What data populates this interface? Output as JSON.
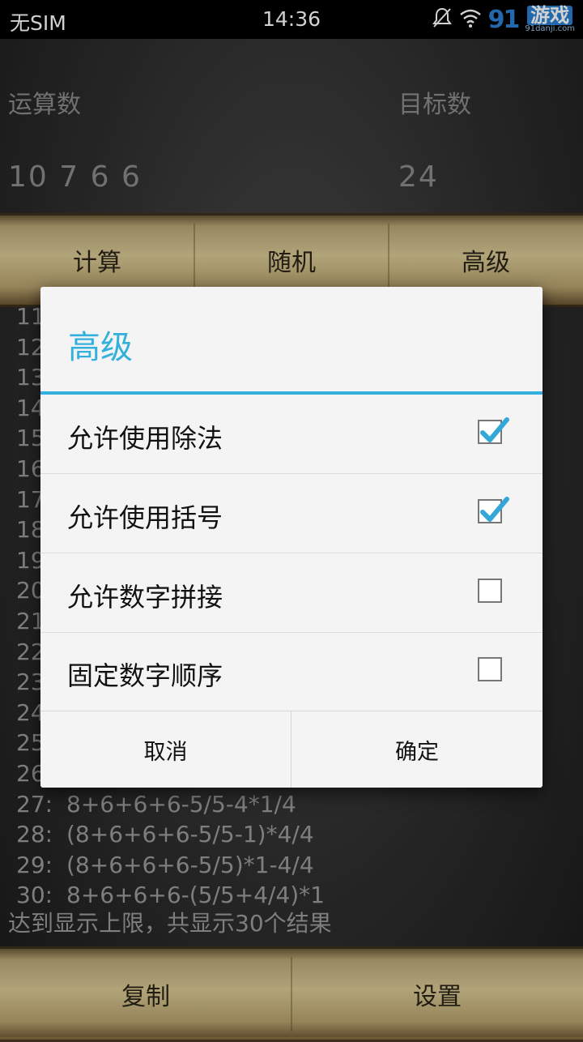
{
  "status_bar": {
    "carrier": "无SIM",
    "time": "14:36",
    "watermark_number": "91",
    "watermark_text": "游戏",
    "watermark_site": "91danji.com"
  },
  "inputs": {
    "operands_label": "运算数",
    "operands_value": "10 7 6 6",
    "target_label": "目标数",
    "target_value": "24"
  },
  "toolbar": {
    "calculate": "计算",
    "random": "随机",
    "advanced": "高级"
  },
  "results": [
    {
      "idx": "11",
      "expr": ""
    },
    {
      "idx": "12",
      "expr": ""
    },
    {
      "idx": "13",
      "expr": ""
    },
    {
      "idx": "14",
      "expr": ""
    },
    {
      "idx": "15",
      "expr": ""
    },
    {
      "idx": "16",
      "expr": ""
    },
    {
      "idx": "17",
      "expr": ""
    },
    {
      "idx": "18",
      "expr": ""
    },
    {
      "idx": "19",
      "expr": ""
    },
    {
      "idx": "20",
      "expr": ""
    },
    {
      "idx": "21",
      "expr": ""
    },
    {
      "idx": "22",
      "expr": ""
    },
    {
      "idx": "23",
      "expr": ""
    },
    {
      "idx": "24",
      "expr": ""
    },
    {
      "idx": "25",
      "expr": ""
    },
    {
      "idx": "26",
      "expr": ""
    },
    {
      "idx": "27:",
      "expr": "8+6+6+6-5/5-4*1/4"
    },
    {
      "idx": "28:",
      "expr": "(8+6+6+6-5/5-1)*4/4"
    },
    {
      "idx": "29:",
      "expr": "(8+6+6+6-5/5)*1-4/4"
    },
    {
      "idx": "30:",
      "expr": "8+6+6+6-(5/5+4/4)*1"
    }
  ],
  "summary": "达到显示上限，共显示30个结果",
  "bottom_bar": {
    "copy": "复制",
    "settings": "设置"
  },
  "dialog": {
    "title": "高级",
    "accent_color": "#33b0dc",
    "options": [
      {
        "label": "允许使用除法",
        "checked": true
      },
      {
        "label": "允许使用括号",
        "checked": true
      },
      {
        "label": "允许数字拼接",
        "checked": false
      },
      {
        "label": "固定数字顺序",
        "checked": false
      }
    ],
    "cancel": "取消",
    "ok": "确定"
  }
}
